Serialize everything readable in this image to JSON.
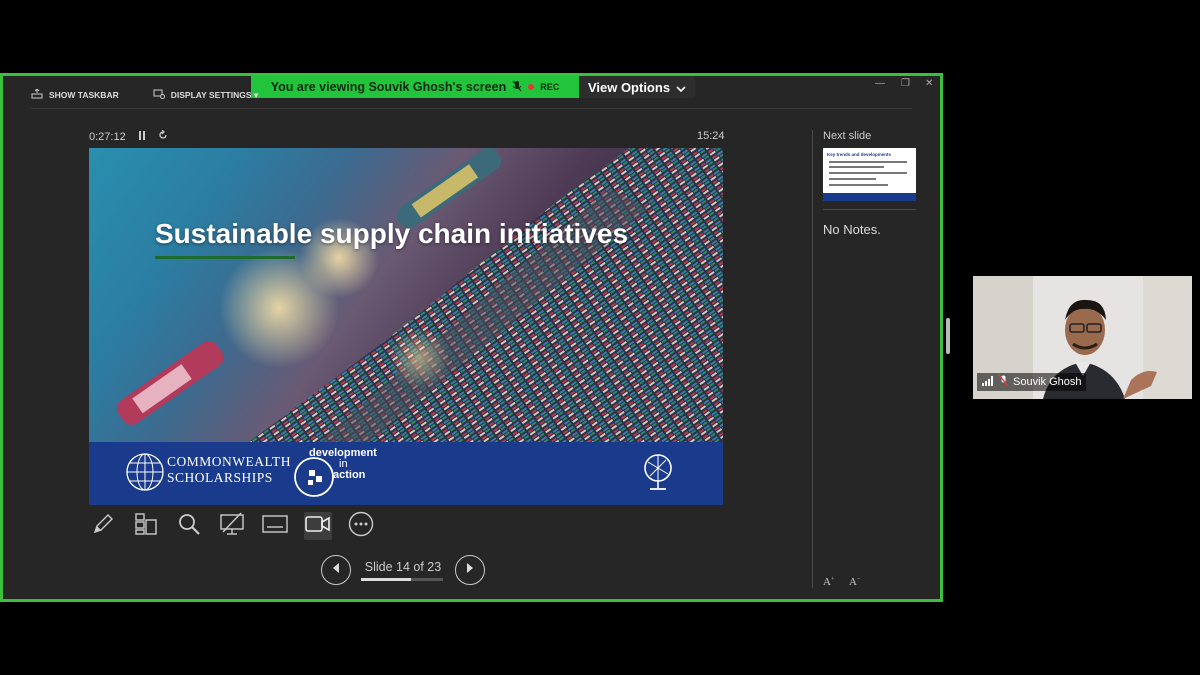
{
  "banner": {
    "viewing_text": "You are viewing  Souvik Ghosh's screen",
    "rec_label": "REC",
    "view_options_label": "View Options"
  },
  "toolbar": {
    "show_taskbar_label": "SHOW TASKBAR",
    "display_settings_label": "DISPLAY SETTINGS ▾"
  },
  "presenter": {
    "elapsed_time": "0:27:12",
    "clock": "15:24",
    "slide": {
      "title": "Sustainable supply chain initiatives",
      "logo_commonwealth_line1": "COMMONWEALTH",
      "logo_commonwealth_line2": "SCHOLARSHIPS",
      "logo_dia_line1": "development",
      "logo_dia_line2": "in",
      "logo_dia_line3": "action"
    },
    "next_slide_label": "Next slide",
    "next_slide_thumb_title": "Key trends and developments",
    "notes_text": "No Notes.",
    "slide_counter": "Slide 14 of 23",
    "progress": 0.6087,
    "tools": [
      "pen-tool",
      "slide-sorter",
      "zoom",
      "black-screen",
      "subtitles",
      "camera-toggle",
      "more-options"
    ]
  },
  "video": {
    "participant_name": "Souvik Ghosh"
  },
  "colors": {
    "share_border": "#3cc03c",
    "banner_green": "#22c43b",
    "slide_band": "#1a3a8c"
  }
}
